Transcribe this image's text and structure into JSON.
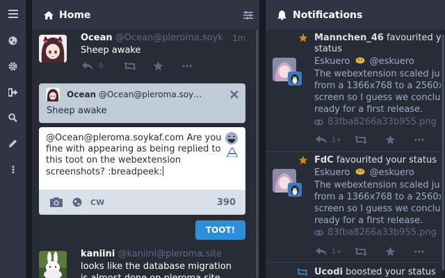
{
  "home": {
    "title": "Home",
    "statuses": [
      {
        "name": "Ocean",
        "acct": "@Ocean@pleroma.soyk",
        "time": "1m",
        "text": "Sheep awake",
        "reply_count": "0"
      },
      {
        "name": "kaniini",
        "acct": "@kaniini@pleroma.site",
        "text_lines": [
          "looks like the database migration",
          "is almost done on pleroma.site"
        ]
      }
    ],
    "reply_to": {
      "name": "Ocean",
      "acct": "@Ocean@pleroma.soy…",
      "text": "Sheep awake"
    },
    "composer": {
      "lines": [
        "@Ocean@pleroma.soykaf.com Are you",
        "fine with appearing as being replied to",
        "this toot on the webextension",
        "screenshots? :breadpeek:"
      ],
      "cw_label": "CW",
      "char_count": "390",
      "submit_label": "TOOT!"
    }
  },
  "notifications": {
    "title": "Notifications",
    "items": [
      {
        "line_bold": "Mannchen_46",
        "line_rest": " favourited y…",
        "line2": "status",
        "name": "Eskuero",
        "acct": "@eskuero",
        "text_lines": [
          "The webextension scaled ju…",
          "from a 1366x768 to a 2560x…",
          "screen so I guess we conclu…",
          "ready for a first release."
        ],
        "attachment": "83fba8266a33b955.png",
        "reply_count": "1+"
      },
      {
        "line_bold": "FdC",
        "line_rest": " favourited your status",
        "name": "Eskuero",
        "acct": "@eskuero",
        "text_lines": [
          "The webextension scaled ju…",
          "from a 1366x768 to a 2560x…",
          "screen so I guess we conclu…",
          "ready for a first release."
        ],
        "attachment": "83fba8266a33b955.png",
        "reply_count": "1+"
      },
      {
        "line_bold": "Ucodi",
        "line_rest": " boosted your status"
      }
    ]
  },
  "colors": {
    "accent": "#2b90d9",
    "favourite": "#ca8f04",
    "boost": "#2b90d9",
    "panel": "#282c37",
    "background": "#191b22"
  }
}
